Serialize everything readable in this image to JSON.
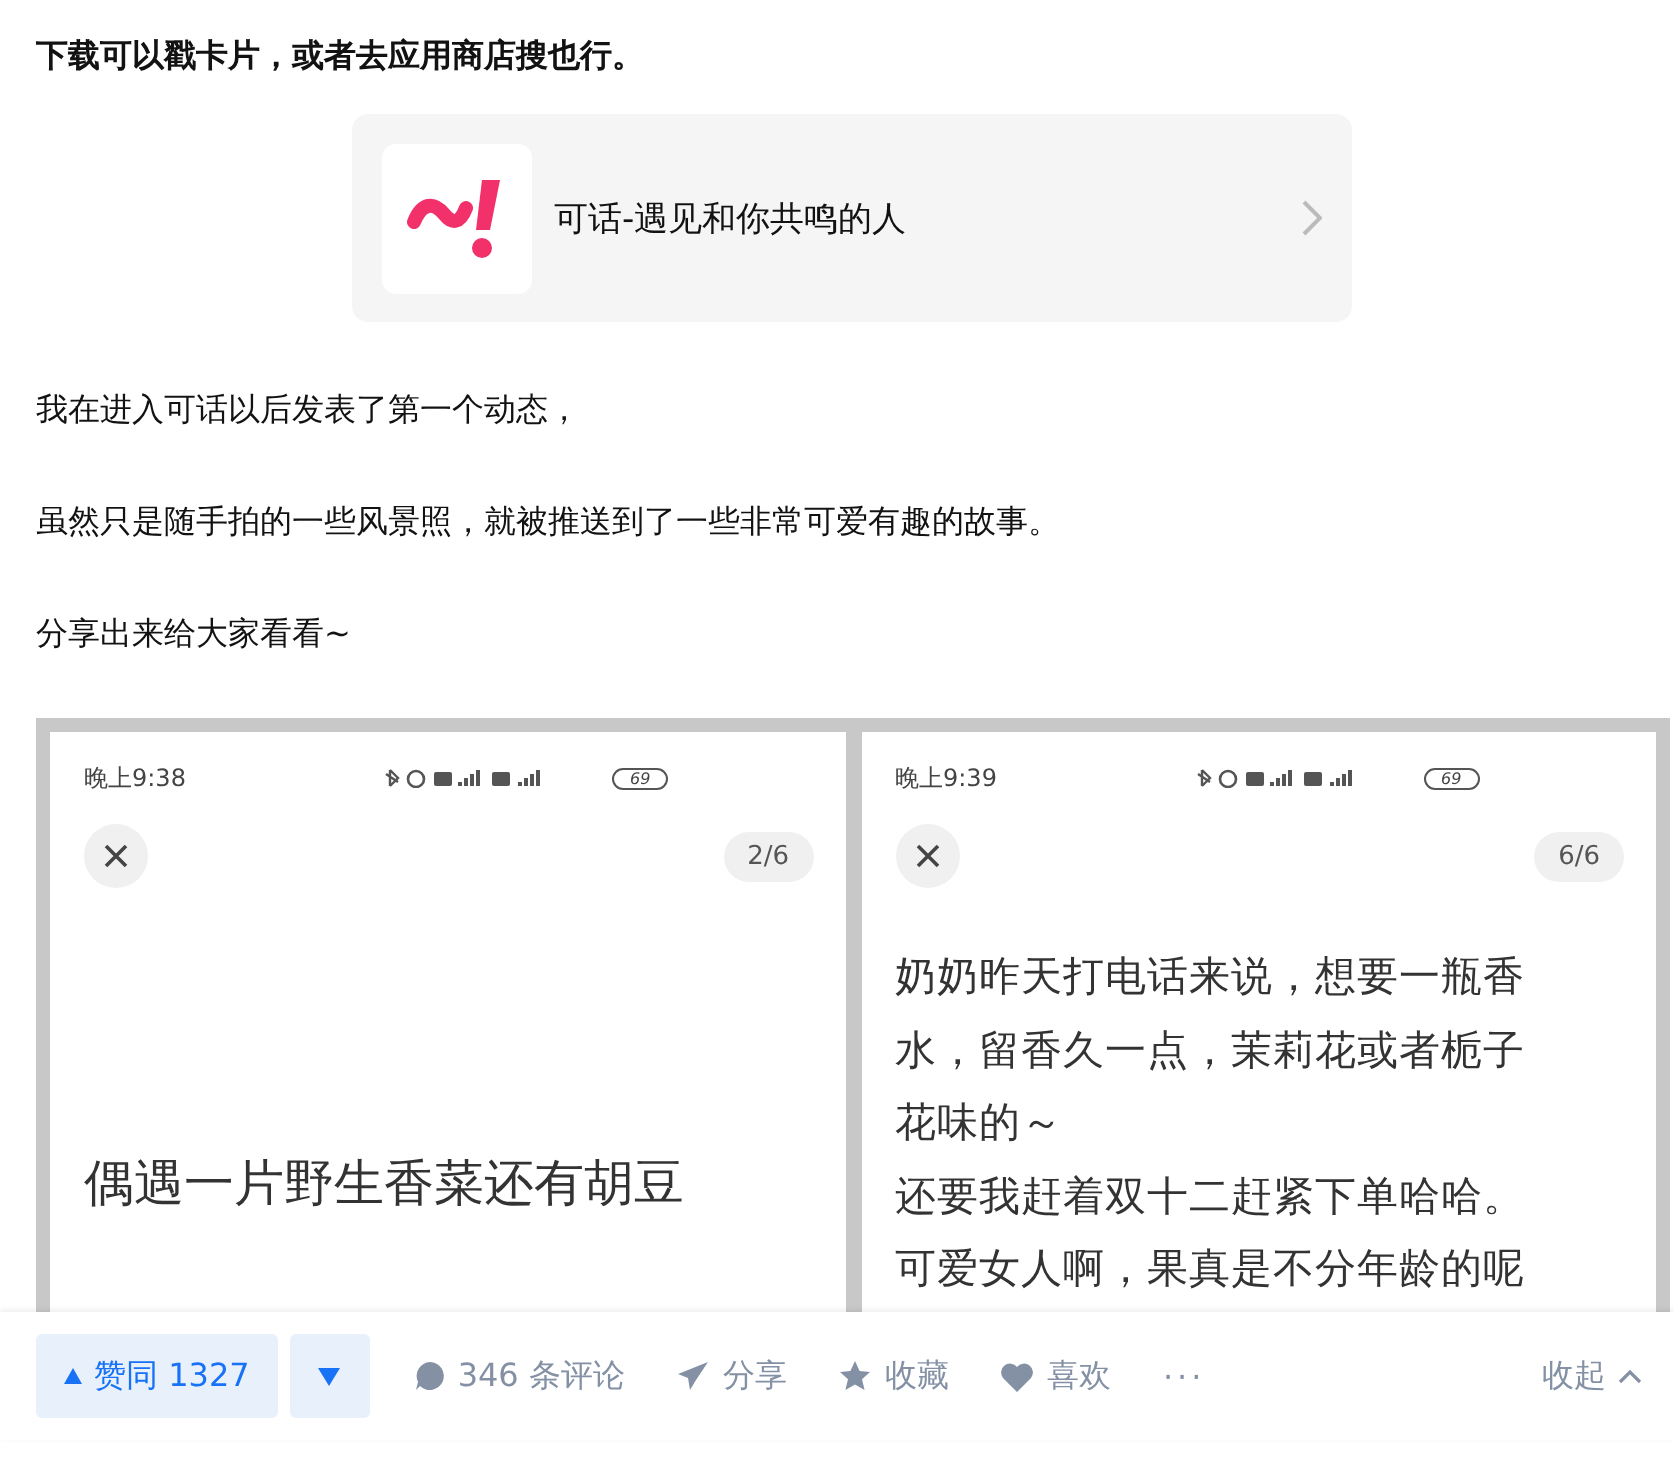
{
  "intro": "下载可以戳卡片，或者去应用商店搜也行。",
  "app_card": {
    "title": "可话-遇见和你共鸣的人"
  },
  "paragraphs": [
    "我在进入可话以后发表了第一个动态，",
    "虽然只是随手拍的一些风景照，就被推送到了一些非常可爱有趣的故事。",
    "分享出来给大家看看~"
  ],
  "screenshots": [
    {
      "kind": "caption",
      "time": "晚上9:38",
      "battery": "69",
      "page": "2/6",
      "lines": [
        "偶遇一片野生香菜还有胡豆"
      ]
    },
    {
      "kind": "post",
      "time": "晚上9:39",
      "battery": "69",
      "page": "6/6",
      "lines": [
        "奶奶昨天打电话来说，想要一瓶香",
        "水，留香久一点，茉莉花或者栀子",
        "花味的～",
        "还要我赶着双十二赶紧下单哈哈。",
        "可爱女人啊，果真是不分年龄的呢"
      ]
    }
  ],
  "actions": {
    "upvote": "赞同 1327",
    "comments": "346 条评论",
    "share": "分享",
    "favorite": "收藏",
    "like": "喜欢",
    "more": "···",
    "collapse": "收起"
  }
}
